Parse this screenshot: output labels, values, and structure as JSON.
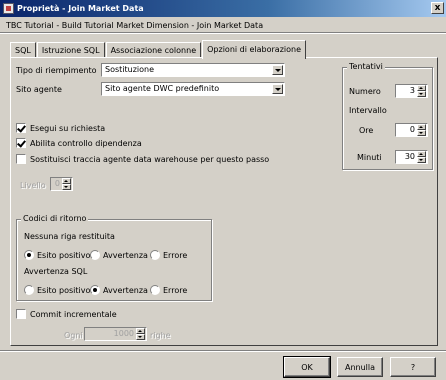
{
  "window": {
    "title": "Proprietà - Join Market Data",
    "close": "x"
  },
  "subtitle": "TBC Tutorial - Build Tutorial Market Dimension - Join Market Data",
  "tabs": [
    {
      "label": "SQL"
    },
    {
      "label": "Istruzione SQL"
    },
    {
      "label": "Associazione colonne"
    },
    {
      "label": "Opzioni di elaborazione",
      "active": true
    }
  ],
  "fill": {
    "label": "Tipo di riempimento",
    "value": "Sostituzione"
  },
  "agent": {
    "label": "Sito agente",
    "value": "Sito agente DWC predefinito"
  },
  "options": {
    "run_on_demand": {
      "label": "Esegui su richiesta",
      "checked": true
    },
    "dependency": {
      "label": "Abilita controllo dipendenza",
      "checked": true
    },
    "replace_trace": {
      "label": "Sostituisci traccia agente data warehouse per questo passo",
      "checked": false
    }
  },
  "level": {
    "label": "Livello",
    "value": "0"
  },
  "retries": {
    "title": "Tentativi",
    "number_label": "Numero",
    "number_value": "3",
    "interval_label": "Intervallo",
    "hours_label": "Ore",
    "hours_value": "0",
    "minutes_label": "Minuti",
    "minutes_value": "30"
  },
  "return_codes": {
    "title": "Codici di ritorno",
    "no_rows": {
      "label": "Nessuna riga restituita",
      "options": [
        "Esito positivo",
        "Avvertenza",
        "Errore"
      ],
      "selected": 0
    },
    "sql_warning": {
      "label": "Avvertenza SQL",
      "options": [
        "Esito positivo",
        "Avvertenza",
        "Errore"
      ],
      "selected": 1
    }
  },
  "commit": {
    "label": "Commit incrementale",
    "checked": false,
    "every_label": "Ogni",
    "every_value": "1000",
    "rows_label": "righe"
  },
  "buttons": {
    "ok": "OK",
    "cancel": "Annulla",
    "help": "?"
  }
}
